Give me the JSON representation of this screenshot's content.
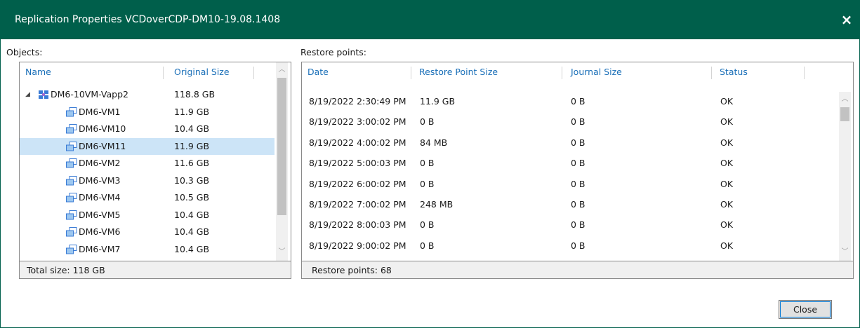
{
  "window": {
    "title": "Replication Properties VCDoverCDP-DM10-19.08.1408",
    "close_icon": "×"
  },
  "objects": {
    "label": "Objects:",
    "columns": [
      "Name",
      "Original Size"
    ],
    "rows": [
      {
        "name": "DM6-10VM-Vapp2",
        "size": "118.8 GB",
        "type": "vapp",
        "expanded": true
      },
      {
        "name": "DM6-VM1",
        "size": "11.9 GB",
        "type": "vm"
      },
      {
        "name": "DM6-VM10",
        "size": "10.4 GB",
        "type": "vm"
      },
      {
        "name": "DM6-VM11",
        "size": "11.9 GB",
        "type": "vm",
        "selected": true
      },
      {
        "name": "DM6-VM2",
        "size": "11.6 GB",
        "type": "vm"
      },
      {
        "name": "DM6-VM3",
        "size": "10.3 GB",
        "type": "vm"
      },
      {
        "name": "DM6-VM4",
        "size": "10.5 GB",
        "type": "vm"
      },
      {
        "name": "DM6-VM5",
        "size": "10.4 GB",
        "type": "vm"
      },
      {
        "name": "DM6-VM6",
        "size": "10.4 GB",
        "type": "vm"
      },
      {
        "name": "DM6-VM7",
        "size": "10.4 GB",
        "type": "vm"
      }
    ],
    "footer": "Total size: 118 GB"
  },
  "restore_points": {
    "label": "Restore points:",
    "columns": [
      "Date",
      "Restore Point Size",
      "Journal Size",
      "Status"
    ],
    "rows": [
      {
        "date": "8/19/2022 2:30:49 PM",
        "size": "11.9 GB",
        "journal": "0 B",
        "status": "OK"
      },
      {
        "date": "8/19/2022 3:00:02 PM",
        "size": "0 B",
        "journal": "0 B",
        "status": "OK"
      },
      {
        "date": "8/19/2022 4:00:02 PM",
        "size": "84 MB",
        "journal": "0 B",
        "status": "OK"
      },
      {
        "date": "8/19/2022 5:00:03 PM",
        "size": "0 B",
        "journal": "0 B",
        "status": "OK"
      },
      {
        "date": "8/19/2022 6:00:02 PM",
        "size": "0 B",
        "journal": "0 B",
        "status": "OK"
      },
      {
        "date": "8/19/2022 7:00:02 PM",
        "size": "248 MB",
        "journal": "0 B",
        "status": "OK"
      },
      {
        "date": "8/19/2022 8:00:03 PM",
        "size": "0 B",
        "journal": "0 B",
        "status": "OK"
      },
      {
        "date": "8/19/2022 9:00:02 PM",
        "size": "0 B",
        "journal": "0 B",
        "status": "OK"
      }
    ],
    "footer": "Restore points: 68"
  },
  "buttons": {
    "close": "Close"
  },
  "colors": {
    "titlebar": "#005f4b",
    "header_text": "#1a6fb8",
    "selection": "#cce4f7"
  }
}
